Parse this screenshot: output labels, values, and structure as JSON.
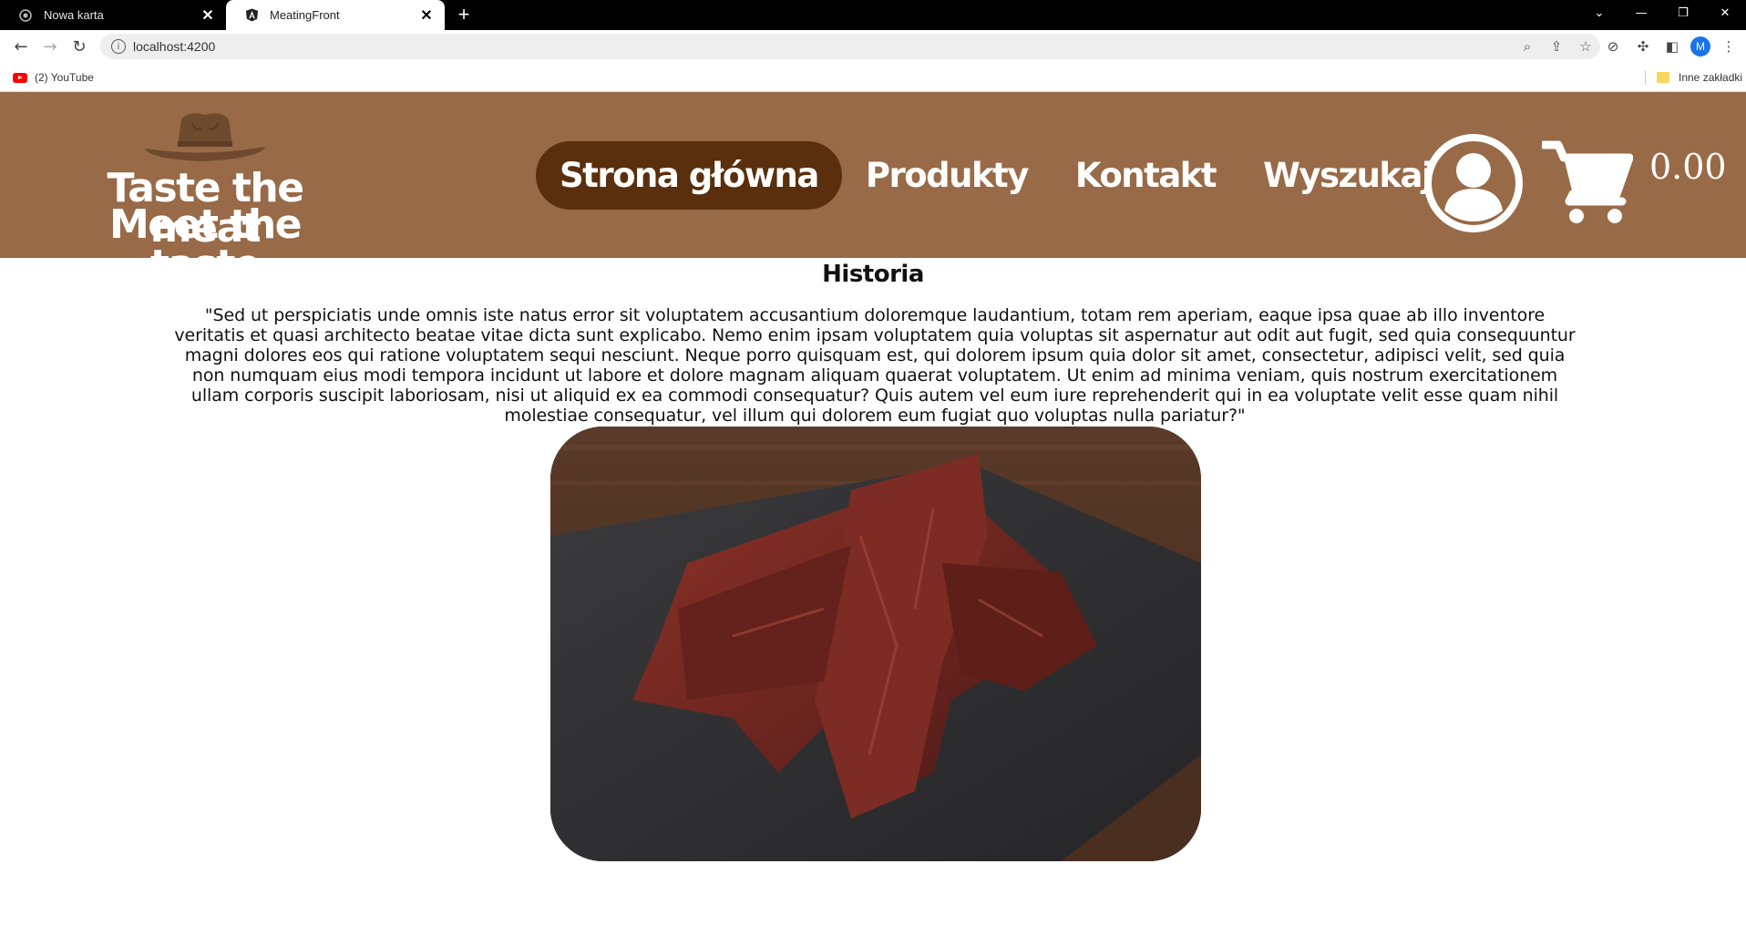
{
  "browser": {
    "tabs": [
      {
        "title": "Nowa karta",
        "active": false
      },
      {
        "title": "MeatingFront",
        "active": true
      }
    ],
    "new_tab_label": "+",
    "close_glyph": "✕",
    "url": "localhost:4200",
    "profile_initial": "M",
    "bookmarks": [
      {
        "label": "(2) YouTube",
        "icon": "youtube-icon"
      }
    ],
    "other_bookmarks_label": "Inne zakładki"
  },
  "site": {
    "logo": {
      "line1": "Taste the meat",
      "line2": "Meet the taste",
      "icon": "cowboy-hat-icon"
    },
    "nav": [
      {
        "label": "Strona główna",
        "active": true
      },
      {
        "label": "Produkty",
        "active": false
      },
      {
        "label": "Kontakt",
        "active": false
      },
      {
        "label": "Wyszukaj",
        "active": false
      }
    ],
    "account_icon": "user-circle-icon",
    "cart_icon": "shopping-cart-icon",
    "cart_total": "0.00"
  },
  "history": {
    "title": "Historia",
    "text": "\"Sed ut perspiciatis unde omnis iste natus error sit voluptatem accusantium doloremque laudantium, totam rem aperiam, eaque ipsa quae ab illo inventore veritatis et quasi architecto beatae vitae dicta sunt explicabo. Nemo enim ipsam voluptatem quia voluptas sit aspernatur aut odit aut fugit, sed quia consequuntur magni dolores eos qui ratione voluptatem sequi nesciunt. Neque porro quisquam est, qui dolorem ipsum quia dolor sit amet, consectetur, adipisci velit, sed quia non numquam eius modi tempora incidunt ut labore et dolore magnam aliquam quaerat voluptatem. Ut enim ad minima veniam, quis nostrum exercitationem ullam corporis suscipit laboriosam, nisi ut aliquid ex ea commodi consequatur? Quis autem vel eum iure reprehenderit qui in ea voluptate velit esse quam nihil molestiae consequatur, vel illum qui dolorem eum fugiat quo voluptas nulla pariatur?\"",
    "image": "beef-jerky-photo"
  },
  "colors": {
    "header_bg": "#986a47",
    "nav_active_bg": "#5a2f0d",
    "hat": "#6e4a2e"
  }
}
